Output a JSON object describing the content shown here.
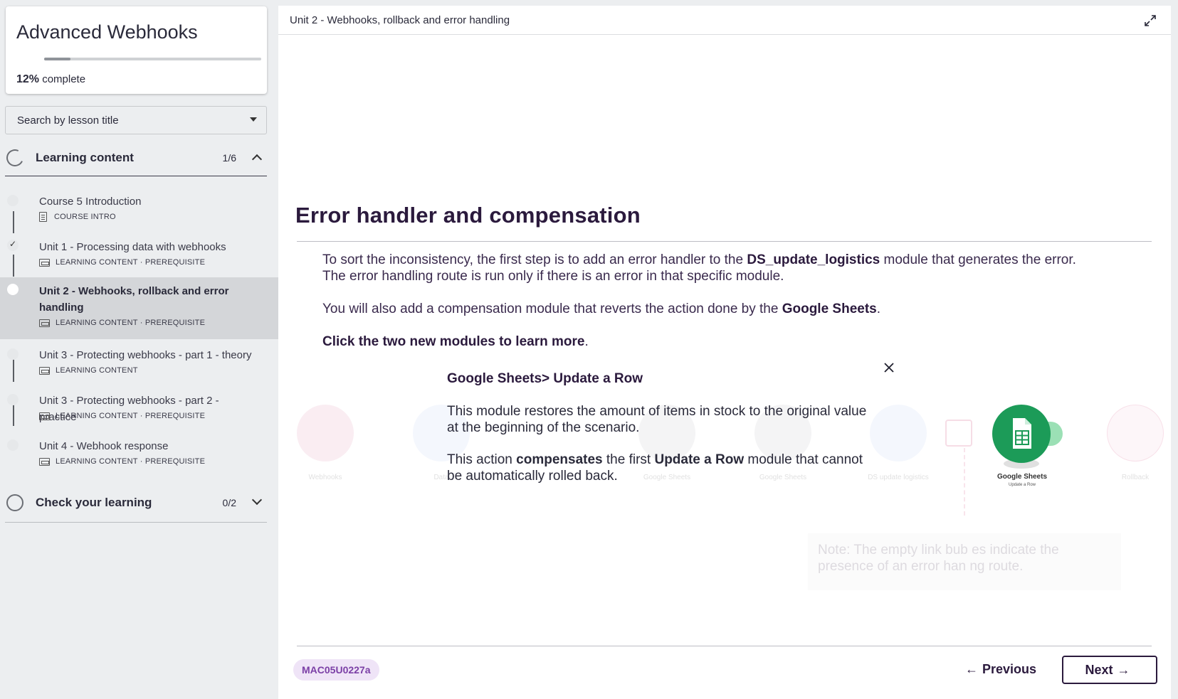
{
  "sidebar": {
    "course_title": "Advanced Webhooks",
    "progress_value": "12%",
    "progress_label": "complete",
    "progress_fraction": 0.12,
    "search_placeholder": "Search by lesson title",
    "sections": [
      {
        "title": "Learning content",
        "count": "1/6",
        "state": "expanded"
      },
      {
        "title": "Check your learning",
        "count": "0/2",
        "state": "collapsed"
      }
    ],
    "lessons": [
      {
        "title": "Course 5 Introduction",
        "meta": "COURSE INTRO",
        "status": "not-started",
        "icon": "document-icon"
      },
      {
        "title": "Unit 1 - Processing data with webhooks",
        "meta": "LEARNING CONTENT · PREREQUISITE",
        "status": "completed",
        "icon": "slides-icon"
      },
      {
        "title": "Unit 2 - Webhooks, rollback and error handling",
        "meta": "LEARNING CONTENT · PREREQUISITE",
        "status": "current",
        "icon": "slides-icon"
      },
      {
        "title": "Unit 3 - Protecting webhooks - part 1 - theory",
        "meta": "LEARNING CONTENT",
        "status": "not-started",
        "icon": "slides-icon"
      },
      {
        "title": "Unit 3 - Protecting webhooks - part 2 - practice",
        "meta": "LEARNING CONTENT · PREREQUISITE",
        "status": "not-started",
        "icon": "slides-icon"
      },
      {
        "title": "Unit 4 - Webhook response",
        "meta": "LEARNING CONTENT · PREREQUISITE",
        "status": "not-started",
        "icon": "slides-icon"
      }
    ]
  },
  "main": {
    "topbar_title": "Unit 2 - Webhooks, rollback and error handling",
    "heading": "Error handler and compensation",
    "paragraph1": {
      "before": "To sort the inconsistency, the first step is to add an error handler to the ",
      "bold": "DS_update_logistics",
      "after": " module that generates the error.",
      "line2": "The error handling route is run only if there is an error in that specific module."
    },
    "paragraph2": {
      "before": "You will also add a compensation module that reverts the action done by the ",
      "bold": "Google Sheets",
      "after": "."
    },
    "paragraph3": {
      "bold": "Click the two new modules to learn more",
      "after": "."
    },
    "diagram": {
      "faded_labels": [
        "Webhooks",
        "Data",
        "Google Sheets",
        "Google Sheets",
        "DS update logistics",
        "Rollback"
      ],
      "faded_note": "Note: The empty link bub  es indicate the presence of an error han  ng route.",
      "module_name": "Google Sheets",
      "module_action": "Update a Row"
    },
    "popup": {
      "title": "Google Sheets> Update a Row",
      "text1": "This module restores the amount of items in stock to the original value",
      "text1b": "at the beginning of the scenario.",
      "text2_before": "This action ",
      "text2_bold1": "compensates",
      "text2_mid": " the first ",
      "text2_bold2": "Update a Row",
      "text2_after": " module that cannot",
      "text2b": "be automatically rolled back."
    },
    "footer": {
      "badge": "MAC05U0227a",
      "previous_label": "Previous",
      "next_label": "Next"
    }
  },
  "colors": {
    "brand_dark": "#2b1a3d",
    "badge_bg": "#efe4f7",
    "badge_text": "#7b3fa6",
    "sheets_green": "#1c9b58"
  }
}
